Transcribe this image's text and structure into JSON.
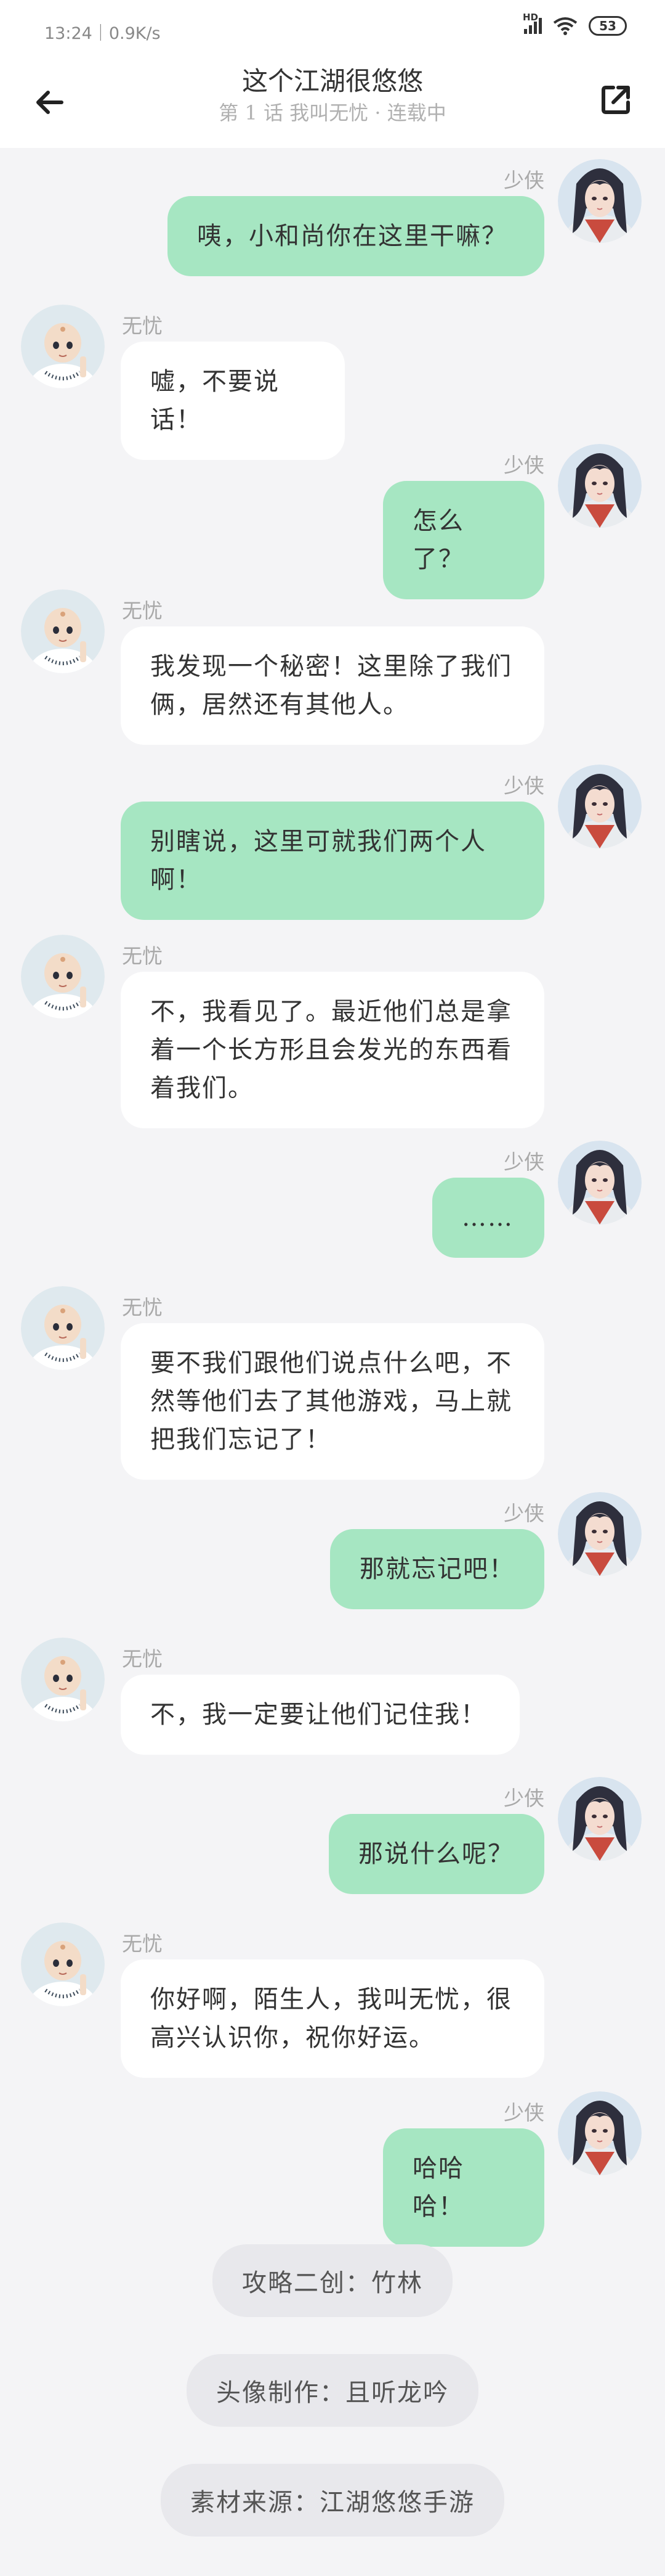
{
  "status": {
    "time": "13:24",
    "speed": "0.9K/s",
    "network": "HD",
    "battery": "53"
  },
  "header": {
    "title": "这个江湖很悠悠",
    "subtitle": "第 1 话 我叫无忧 · 连载中"
  },
  "messages": [
    {
      "side": "right",
      "speaker": "少侠",
      "text": "咦，小和尚你在这里干嘛？",
      "avatar": "swordsman-avatar"
    },
    {
      "side": "left",
      "speaker": "无忧",
      "text": "嘘，不要说话！",
      "avatar": "monk-avatar"
    },
    {
      "side": "right",
      "speaker": "少侠",
      "text": "怎么了？",
      "avatar": "swordsman-avatar"
    },
    {
      "side": "left",
      "speaker": "无忧",
      "text": "我发现一个秘密！这里除了我们俩，居然还有其他人。",
      "avatar": "monk-avatar"
    },
    {
      "side": "right",
      "speaker": "少侠",
      "text": "别瞎说，这里可就我们两个人啊！",
      "avatar": "swordsman-avatar"
    },
    {
      "side": "left",
      "speaker": "无忧",
      "text": "不，我看见了。最近他们总是拿着一个长方形且会发光的东西看着我们。",
      "avatar": "monk-avatar"
    },
    {
      "side": "right",
      "speaker": "少侠",
      "text": "……",
      "avatar": "swordsman-avatar"
    },
    {
      "side": "left",
      "speaker": "无忧",
      "text": "要不我们跟他们说点什么吧，不然等他们去了其他游戏，马上就把我们忘记了！",
      "avatar": "monk-avatar"
    },
    {
      "side": "right",
      "speaker": "少侠",
      "text": "那就忘记吧！",
      "avatar": "swordsman-avatar"
    },
    {
      "side": "left",
      "speaker": "无忧",
      "text": "不，我一定要让他们记住我！",
      "avatar": "monk-avatar"
    },
    {
      "side": "right",
      "speaker": "少侠",
      "text": "那说什么呢？",
      "avatar": "swordsman-avatar"
    },
    {
      "side": "left",
      "speaker": "无忧",
      "text": "你好啊，陌生人，我叫无忧，很高兴认识你，祝你好运。",
      "avatar": "monk-avatar"
    },
    {
      "side": "right",
      "speaker": "少侠",
      "text": "哈哈哈！",
      "avatar": "swordsman-avatar"
    }
  ],
  "credits": [
    "攻略二创：竹林",
    "头像制作：且听龙吟",
    "素材来源：江湖悠悠手游"
  ],
  "colors": {
    "bubble_self": "#a6e6c2",
    "bubble_other": "#ffffff",
    "background": "#f4f4f6"
  }
}
